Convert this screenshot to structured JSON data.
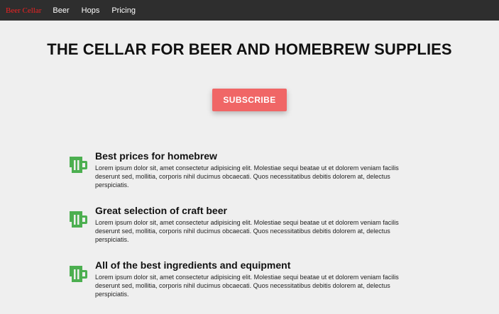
{
  "nav": {
    "brand": "Beer Cellar",
    "links": [
      "Beer",
      "Hops",
      "Pricing"
    ]
  },
  "hero": {
    "title": "THE CELLAR FOR BEER AND HOMEBREW SUPPLIES",
    "subscribe_label": "SUBSCRIBE"
  },
  "features": [
    {
      "icon": "beer-mug-icon",
      "title": "Best prices for homebrew",
      "text": "Lorem ipsum dolor sit, amet consectetur adipisicing elit. Molestiae sequi beatae ut et dolorem veniam facilis deserunt sed, mollitia, corporis nihil ducimus obcaecati. Quos necessitatibus debitis dolorem at, delectus perspiciatis."
    },
    {
      "icon": "beer-mug-icon",
      "title": "Great selection of craft beer",
      "text": "Lorem ipsum dolor sit, amet consectetur adipisicing elit. Molestiae sequi beatae ut et dolorem veniam facilis deserunt sed, mollitia, corporis nihil ducimus obcaecati. Quos necessitatibus debitis dolorem at, delectus perspiciatis."
    },
    {
      "icon": "beer-mug-icon",
      "title": "All of the best ingredients and equipment",
      "text": "Lorem ipsum dolor sit, amet consectetur adipisicing elit. Molestiae sequi beatae ut et dolorem veniam facilis deserunt sed, mollitia, corporis nihil ducimus obcaecati. Quos necessitatibus debitis dolorem at, delectus perspiciatis."
    }
  ],
  "colors": {
    "navbar": "#2e2e2e",
    "brand": "#ee2222",
    "accent_button": "#f06666",
    "icon": "#4caf50"
  }
}
